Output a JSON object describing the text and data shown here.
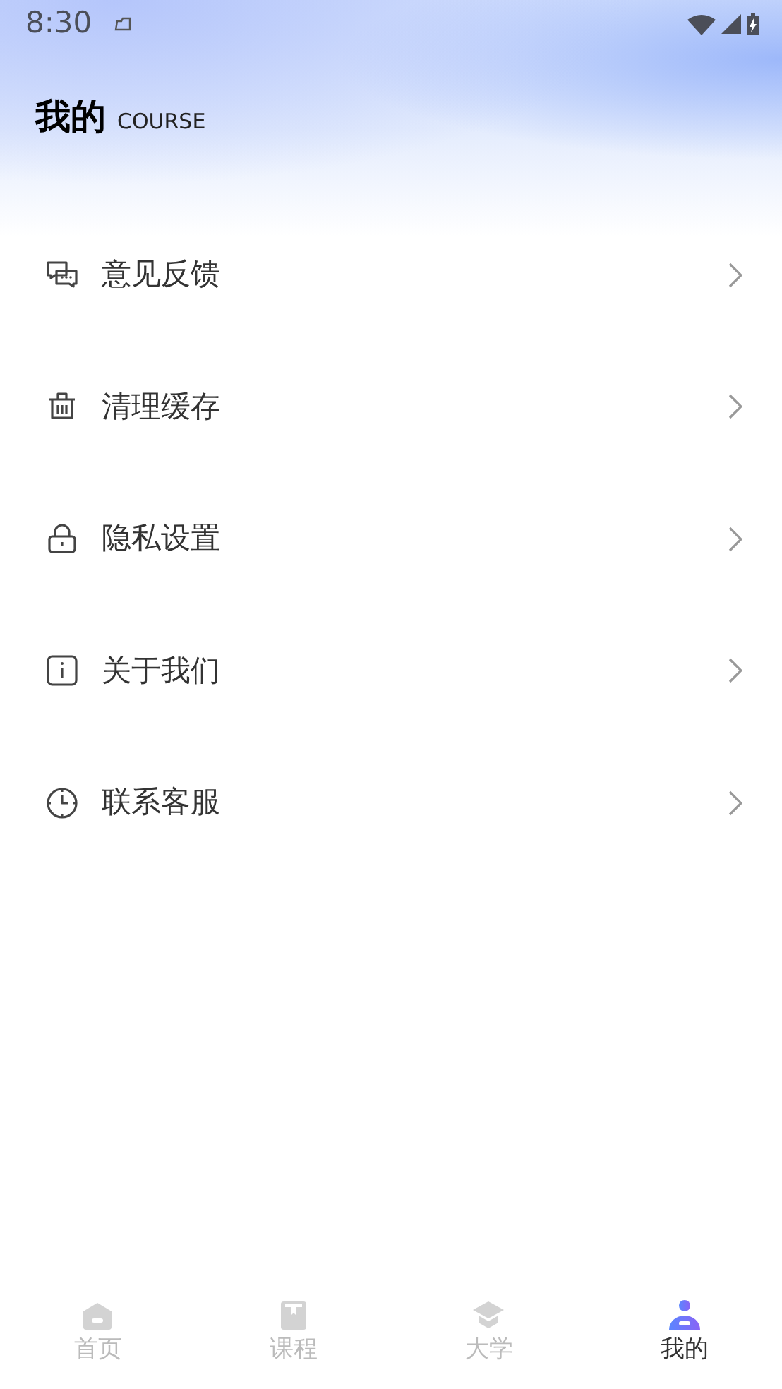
{
  "status_bar": {
    "time": "8:30"
  },
  "header": {
    "title": "我的",
    "subtitle": "COURSE"
  },
  "menu_items": [
    {
      "label": "意见反馈"
    },
    {
      "label": "清理缓存"
    },
    {
      "label": "隐私设置"
    },
    {
      "label": "关于我们"
    },
    {
      "label": "联系客服"
    }
  ],
  "tabs": [
    {
      "label": "首页",
      "selected": false
    },
    {
      "label": "课程",
      "selected": false
    },
    {
      "label": "大学",
      "selected": false
    },
    {
      "label": "我的",
      "selected": true
    }
  ]
}
